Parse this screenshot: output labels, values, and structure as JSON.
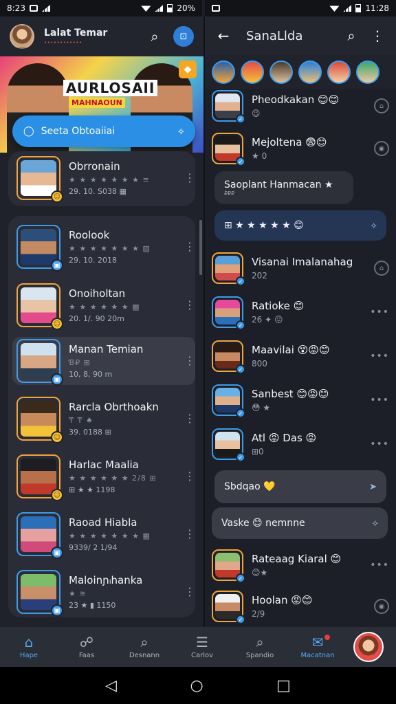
{
  "status_left": {
    "time": "8:23",
    "battery": "20%"
  },
  "status_right": {
    "time": "11:28"
  },
  "left_header": {
    "title": "Lalat Temar",
    "subtitle": "••••••••••••"
  },
  "banner": {
    "title": "AURLOSAII",
    "subtitle": "MAHNAOUN"
  },
  "search_pill": {
    "label": "Seeta Obtoaiiai"
  },
  "left_list": [
    {
      "name": "Obrronain",
      "stars": "★ ★ ★ ★ ★ ★ ★ ≡",
      "meta": "29. 10. S038 ▦",
      "accent": "#f2a53a"
    },
    {
      "name": "Roolook",
      "stars": "★ ★ ★ ★ ★ ★ ★ ▧",
      "meta": "29. 10. 2018",
      "accent": "#3d9be9"
    },
    {
      "name": "Onoiholtan",
      "stars": "★ ★ ★ ★ ★ ★ ▦",
      "meta": "20. 1/. 90 20m",
      "accent": "#f2a53a"
    },
    {
      "name": "Manan Temian",
      "stars": "Ɓ̄₽ ⊞",
      "meta": "10, 8, 90 m",
      "accent": "#3d9be9"
    },
    {
      "name": "Rarcla Obrthoakn",
      "stars": "₸ ₸ ♠",
      "meta": "39. 0188 ⊞",
      "accent": "#f2a53a"
    },
    {
      "name": "Harlac Maalia",
      "stars": "★ ★ ★ ★ ★ ★ 2/8 ⊞",
      "meta": "⊞ ★ ★ 1198",
      "accent": "#f2a53a"
    },
    {
      "name": "Raoad Hiabla",
      "stars": "★ ★ ★ ★ ★ ★ ★ ▦",
      "meta": "9339/ 2 1/94",
      "accent": "#3d9be9"
    },
    {
      "name": "Maloinɲᵢhanka",
      "stars": "★ ≋",
      "meta": "23 ★ ▮ 1150",
      "accent": "#3d9be9"
    }
  ],
  "right_header": {
    "title": "SanaLlda"
  },
  "right_list": [
    {
      "type": "chat",
      "name": "Pheodkakan 😊😊",
      "sub": "😉",
      "accent": "#ffffff",
      "side": "⌂"
    },
    {
      "type": "chat",
      "name": "Mejoltena 😨😊",
      "sub": "★ 0",
      "accent": "#f2a53a",
      "side": "◉"
    },
    {
      "type": "pill",
      "text": "Saoplant Hanmacan ★",
      "sub": "₽₽₽",
      "style": "dark"
    },
    {
      "type": "pill",
      "text": "⊞ ★ ★ ★ ★ ★ 😊",
      "style": "blue",
      "end": "⟡"
    },
    {
      "type": "chat",
      "name": "Visanai Imalanahag",
      "sub": "202",
      "accent": "#f2a53a",
      "side": "⌂"
    },
    {
      "type": "chat",
      "name": "Ratioke 😊",
      "sub": "26 ✦ 😖",
      "accent": "#3d9be9",
      "side": "•••"
    },
    {
      "type": "chat",
      "name": "Maavilai 😵😡😊",
      "sub": "800",
      "accent": "#f2a53a",
      "side": "•••"
    },
    {
      "type": "chat",
      "name": "Sanbest 😊😡😊",
      "sub": "😳 ★",
      "accent": "#3d9be9",
      "side": "•••"
    },
    {
      "type": "chat",
      "name": "Atl 😡 Das 😡",
      "sub": "⊞0",
      "accent": "#3d9be9",
      "side": "•••"
    },
    {
      "type": "pill",
      "text": "Sbdqao 💛",
      "style": "grey",
      "end": "➤"
    },
    {
      "type": "pill",
      "text": "Vaske 😊 nemnne",
      "style": "grey",
      "end": "⟡"
    },
    {
      "type": "chat",
      "name": "Rateaag Kiaral 😊",
      "sub": "😊★",
      "accent": "#f2a53a",
      "side": "•••"
    },
    {
      "type": "chat",
      "name": "Hoolan 😡😊",
      "sub": "2/9",
      "accent": "#f2a53a",
      "side": "◉"
    }
  ],
  "bottom_nav": [
    {
      "label": "Hape",
      "icon": "⌂",
      "active": true
    },
    {
      "label": "Faas",
      "icon": "☍",
      "active": false
    },
    {
      "label": "Desnann",
      "icon": "⌕",
      "active": false
    },
    {
      "label": "Carlov",
      "icon": "☰",
      "active": false
    },
    {
      "label": "Spandio",
      "icon": "⌕",
      "active": false
    },
    {
      "label": "Macatnan",
      "icon": "✉",
      "active": true,
      "badge": true
    }
  ],
  "colors": {
    "accent_blue": "#3d9be9",
    "accent_orange": "#f2a53a",
    "background": "#1b1e26"
  }
}
